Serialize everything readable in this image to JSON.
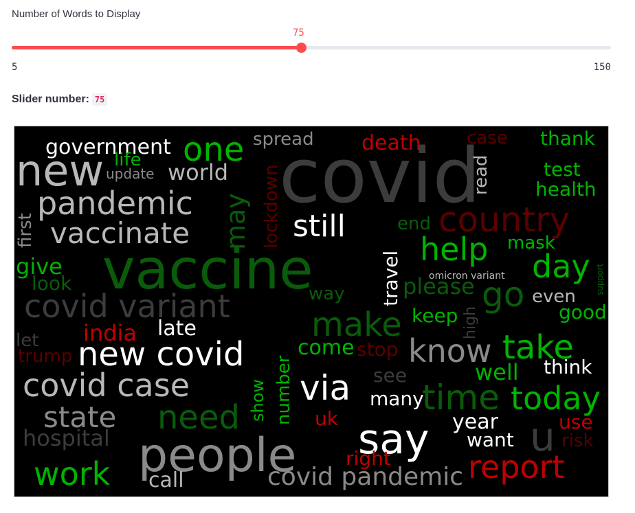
{
  "slider": {
    "label": "Number of Words to Display",
    "value": "75",
    "min": "5",
    "max": "150",
    "fraction": 0.4828
  },
  "result": {
    "label": "Slider number:",
    "value": "75"
  },
  "wordcloud": {
    "background": "#000000",
    "colors": {
      "green": "#00b400",
      "dark_green": "#0a5c0a",
      "red": "#c00000",
      "dark_red": "#5a0000",
      "white": "#ffffff",
      "light_gray": "#b8b8b8",
      "gray": "#8a8a8a",
      "dark_gray": "#3c3c3c"
    },
    "words": [
      "government",
      "new",
      "life",
      "update",
      "world",
      "one",
      "spread",
      "death",
      "case",
      "thank",
      "covid",
      "test",
      "health",
      "read",
      "lockdown",
      "pandemic",
      "first",
      "may",
      "vaccinate",
      "still",
      "end",
      "country",
      "help",
      "mask",
      "give",
      "look",
      "vaccine",
      "day",
      "omicron variant",
      "support",
      "travel",
      "please",
      "way",
      "go",
      "even",
      "covid variant",
      "high",
      "good",
      "make",
      "keep",
      "let",
      "india",
      "late",
      "trump",
      "new covid",
      "come",
      "stop",
      "know",
      "take",
      "think",
      "well",
      "show",
      "number",
      "see",
      "covid case",
      "via",
      "many",
      "time",
      "today",
      "state",
      "need",
      "uk",
      "year",
      "use",
      "want",
      "u",
      "say",
      "risk",
      "hospital",
      "people",
      "right",
      "work",
      "call",
      "covid pandemic",
      "report"
    ]
  }
}
